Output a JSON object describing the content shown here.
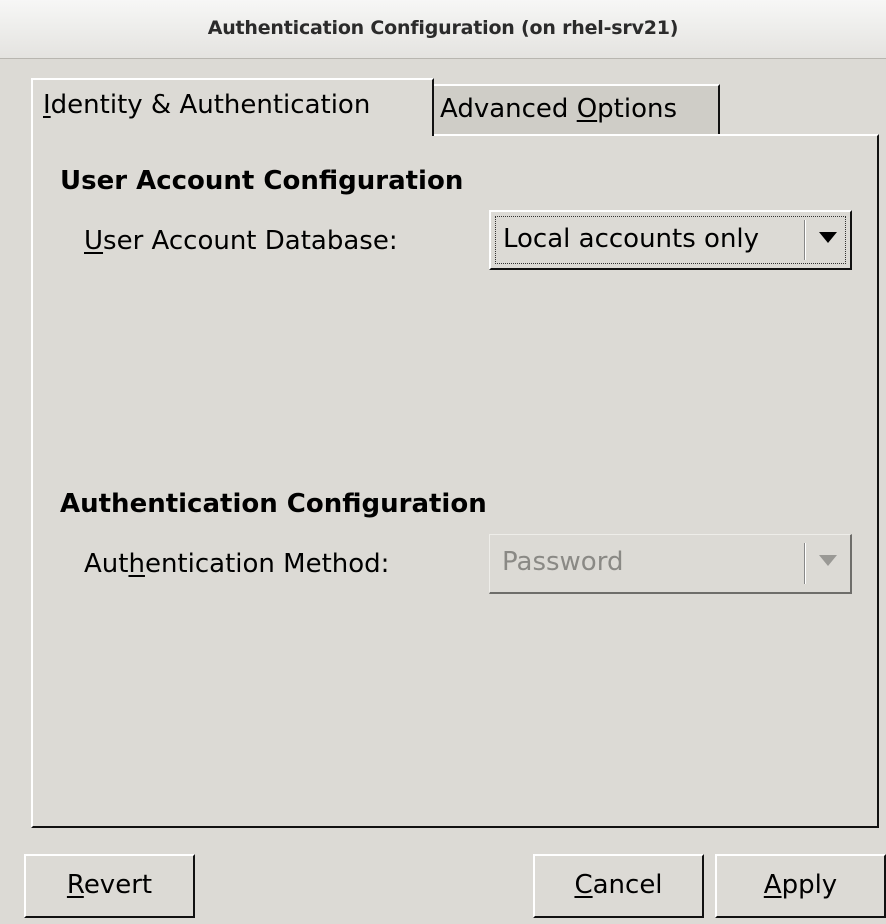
{
  "window": {
    "title": "Authentication Configuration (on rhel-srv21)"
  },
  "tabs": [
    {
      "mnemonic": "I",
      "rest": "dentity & Authentication",
      "active": true
    },
    {
      "before": "Advanced ",
      "mnemonic": "O",
      "after": "ptions",
      "active": false
    }
  ],
  "user_account": {
    "heading": "User Account Configuration",
    "label_mnemonic": "U",
    "label_rest": "ser Account Database:",
    "selected_value": "Local accounts only"
  },
  "authentication": {
    "heading": "Authentication Configuration",
    "label_before": "Aut",
    "label_mnemonic": "h",
    "label_after": "entication Method:",
    "selected_value": "Password",
    "enabled": false
  },
  "buttons": {
    "revert": {
      "mnemonic": "R",
      "rest": "evert"
    },
    "cancel": {
      "mnemonic": "C",
      "rest": "ancel"
    },
    "apply": {
      "mnemonic": "A",
      "rest": "pply"
    }
  },
  "icons": {
    "dropdown": "chevron-down-icon"
  }
}
